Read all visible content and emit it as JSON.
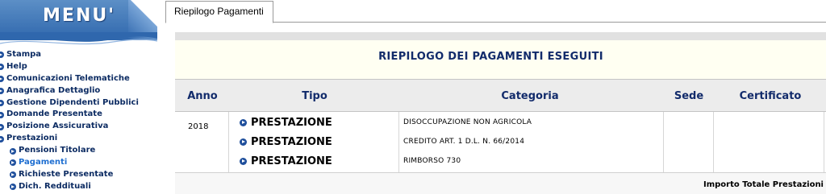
{
  "sidebar": {
    "title": "MENU'",
    "items": [
      {
        "label": "Stampa",
        "level": "top",
        "active": false
      },
      {
        "label": "Help",
        "level": "top",
        "active": false
      },
      {
        "label": "Comunicazioni Telematiche",
        "level": "top",
        "active": false
      },
      {
        "label": "Anagrafica Dettaglio",
        "level": "top",
        "active": false
      },
      {
        "label": "Gestione Dipendenti Pubblici",
        "level": "top",
        "active": false
      },
      {
        "label": "Domande Presentate",
        "level": "top",
        "active": false
      },
      {
        "label": "Posizione Assicurativa",
        "level": "top",
        "active": false
      },
      {
        "label": "Prestazioni",
        "level": "top",
        "active": false
      },
      {
        "label": "Pensioni Titolare",
        "level": "sub",
        "active": false
      },
      {
        "label": "Pagamenti",
        "level": "sub",
        "active": true
      },
      {
        "label": "Richieste Presentate",
        "level": "sub",
        "active": false
      },
      {
        "label": "Dich. Reddituali",
        "level": "sub",
        "active": false
      }
    ]
  },
  "tabs": [
    {
      "label": "Riepilogo Pagamenti",
      "selected": true
    }
  ],
  "summary": {
    "title": "RIEPILOGO DEI PAGAMENTI ESEGUITI"
  },
  "table": {
    "headers": {
      "anno": "Anno",
      "tipo": "Tipo",
      "categoria": "Categoria",
      "sede": "Sede",
      "certificato": "Certificato"
    },
    "year": "2018",
    "rows": [
      {
        "tipo": "PRESTAZIONE",
        "categoria": "DISOCCUPAZIONE NON AGRICOLA",
        "sede": "",
        "certificato": ""
      },
      {
        "tipo": "PRESTAZIONE",
        "categoria": "CREDITO ART. 1 D.L. N. 66/2014",
        "sede": "",
        "certificato": ""
      },
      {
        "tipo": "PRESTAZIONE",
        "categoria": "RIMBORSO 730",
        "sede": "",
        "certificato": ""
      }
    ],
    "footer_label": "Importo Totale Prestazioni"
  },
  "colors": {
    "menu_blue": "#2f67ad",
    "menu_text": "#0d2c63",
    "active_link": "#1f6fd1",
    "header_text": "#122b6b",
    "summary_band": "#fffff2"
  }
}
